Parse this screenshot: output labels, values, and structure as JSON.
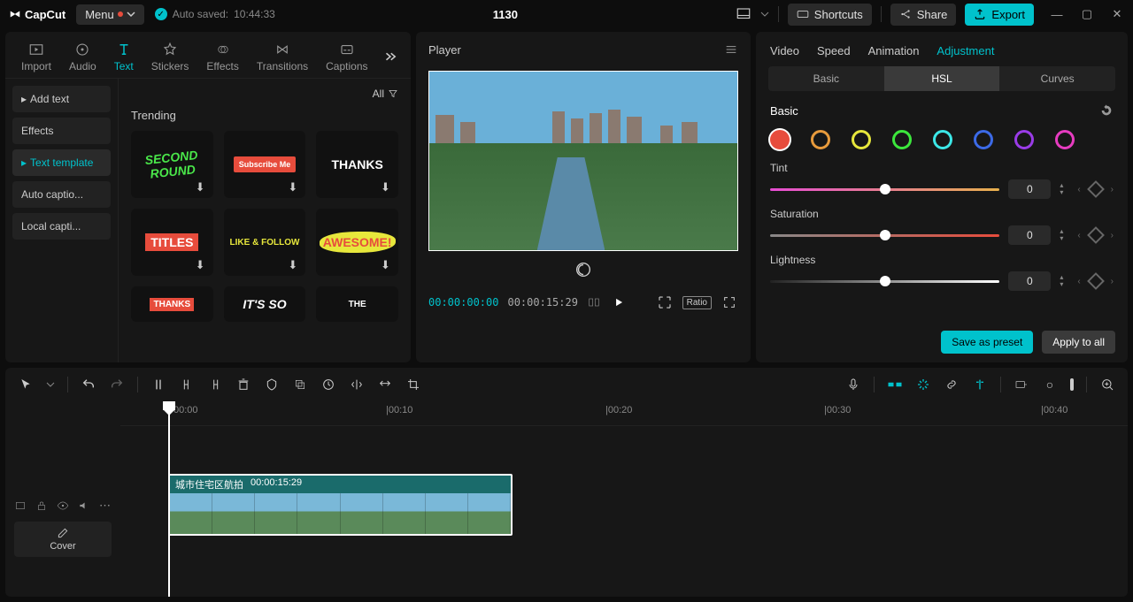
{
  "app": {
    "name": "CapCut"
  },
  "menu": {
    "label": "Menu"
  },
  "autosave": {
    "label": "Auto saved:",
    "time": "10:44:33"
  },
  "project": {
    "name": "1130"
  },
  "topbar": {
    "shortcuts": "Shortcuts",
    "share": "Share",
    "export": "Export"
  },
  "media_tabs": {
    "import": "Import",
    "audio": "Audio",
    "text": "Text",
    "stickers": "Stickers",
    "effects": "Effects",
    "transitions": "Transitions",
    "captions": "Captions"
  },
  "text_sidebar": {
    "add_text": "Add text",
    "effects": "Effects",
    "text_template": "Text template",
    "auto_captions": "Auto captio...",
    "local_captions": "Local capti..."
  },
  "templates": {
    "filter_label": "All",
    "section": "Trending",
    "items": [
      "SECOND ROUND",
      "Subscribe Me",
      "THANKS",
      "TITLES",
      "LIKE & FOLLOW",
      "AWESOME!",
      "THANKS",
      "IT'S SO",
      "THE"
    ]
  },
  "player": {
    "title": "Player",
    "current": "00:00:00:00",
    "duration": "00:00:15:29",
    "ratio_label": "Ratio"
  },
  "right_tabs": {
    "video": "Video",
    "speed": "Speed",
    "animation": "Animation",
    "adjustment": "Adjustment"
  },
  "adj_subtabs": {
    "basic": "Basic",
    "hsl": "HSL",
    "curves": "Curves"
  },
  "hsl": {
    "section": "Basic",
    "swatches": [
      "#e74c3c",
      "#e79a3c",
      "#e7e73c",
      "#3ce73c",
      "#3ce7e7",
      "#3c6ae7",
      "#9a3ce7",
      "#e73cc0"
    ],
    "tint_label": "Tint",
    "tint_value": "0",
    "sat_label": "Saturation",
    "sat_value": "0",
    "light_label": "Lightness",
    "light_value": "0"
  },
  "right_footer": {
    "save": "Save as preset",
    "apply": "Apply to all"
  },
  "timeline": {
    "ticks": [
      "00:00",
      "|00:10",
      "|00:20",
      "|00:30",
      "|00:40"
    ],
    "clip_name": "城市住宅区航拍",
    "clip_dur": "00:00:15:29",
    "cover": "Cover"
  }
}
